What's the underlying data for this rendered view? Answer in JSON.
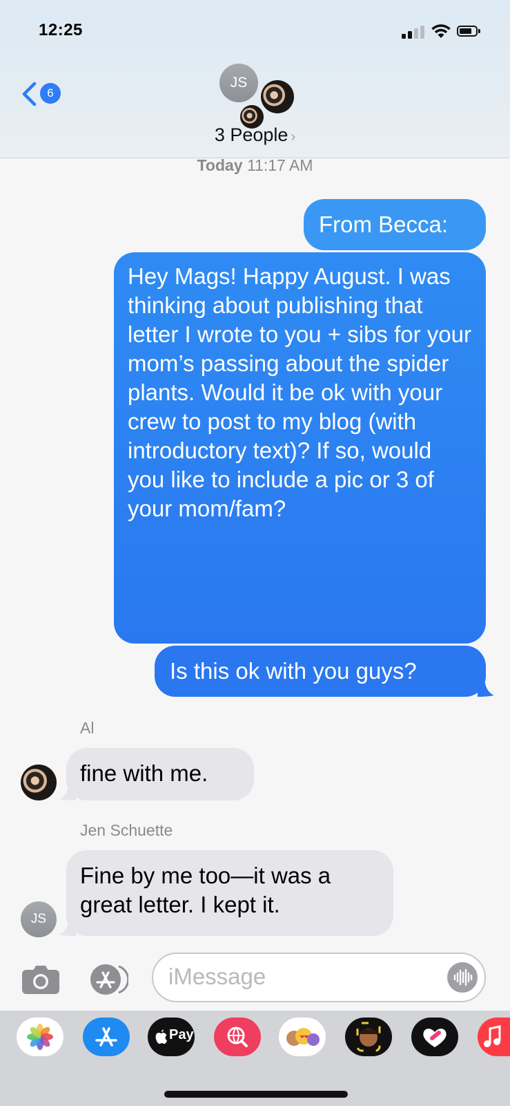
{
  "status_bar": {
    "time": "12:25"
  },
  "header": {
    "back_badge": "6",
    "group_initials": "JS",
    "group_title": "3 People",
    "title_chevron": "›"
  },
  "thread": {
    "timestamp_day": "Today",
    "timestamp_time": "11:17 AM",
    "messages": [
      {
        "direction": "sent",
        "text": "From Becca:"
      },
      {
        "direction": "sent",
        "text": "Hey Mags! Happy August. I was thinking about publishing that letter I wrote to you + sibs for your mom’s passing about the spider plants. Would it be ok with your crew to post to my blog (with introductory text)? If so, would you like to include a pic or 3 of your mom/fam?"
      },
      {
        "direction": "sent",
        "text": "Is this ok with you guys?"
      },
      {
        "direction": "received",
        "sender": "Al",
        "text": "fine with me."
      },
      {
        "direction": "received",
        "sender": "Jen Schuette",
        "sender_initials": "JS",
        "text": "Fine by me too—it was a great letter. I kept it."
      }
    ]
  },
  "composer": {
    "placeholder": "iMessage"
  },
  "app_drawer": {
    "apps": [
      {
        "name": "photos-app-icon"
      },
      {
        "name": "app-store-icon"
      },
      {
        "name": "apple-pay-icon",
        "label": "Pay"
      },
      {
        "name": "images-search-icon"
      },
      {
        "name": "animoji-icon"
      },
      {
        "name": "memoji-stickers-icon"
      },
      {
        "name": "digital-touch-icon"
      },
      {
        "name": "music-icon"
      }
    ]
  },
  "colors": {
    "sent_bubble": "#2a7ef0",
    "received_bubble": "#e5e5ea",
    "accent": "#2e7cf6",
    "background": "#f6f6f7"
  }
}
